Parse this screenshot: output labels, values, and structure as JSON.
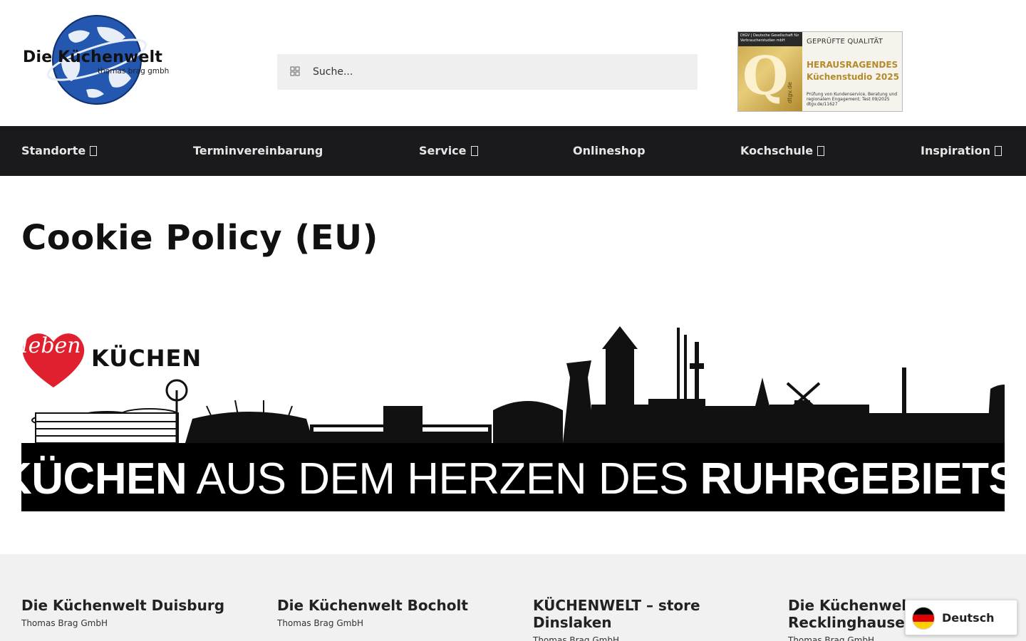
{
  "logo": {
    "title": "Die Küchenwelt",
    "subtitle": "thomas brag gmbh"
  },
  "search": {
    "placeholder": "Suche..."
  },
  "quality_badge": {
    "header": "DtGV | Deutsche Gesellschaft für Verbraucherstudien mbH",
    "vertical": "dtgv.de",
    "line1": "GEPRÜFTE QUALITÄT",
    "line2": "HERAUSRAGENDES",
    "line3": "Küchenstudio 2025",
    "line4": "Prüfung von Kundenservice, Beratung und regionalem Engagement; Test 09/2025 dtgv.de/11627"
  },
  "nav": {
    "items": [
      {
        "label": "Standorte",
        "has_submenu": true
      },
      {
        "label": "Terminvereinbarung",
        "has_submenu": false
      },
      {
        "label": "Service",
        "has_submenu": true
      },
      {
        "label": "Onlineshop",
        "has_submenu": false
      },
      {
        "label": "Kochschule",
        "has_submenu": true
      },
      {
        "label": "Inspiration",
        "has_submenu": true
      }
    ]
  },
  "page": {
    "title": "Cookie Policy (EU)"
  },
  "banner": {
    "heart_text": "leben",
    "word": "KÜCHEN",
    "slogan_part1": "KÜCHEN",
    "slogan_part2": " AUS DEM HERZEN DES ",
    "slogan_part3": "RUHRGEBIETS"
  },
  "footer": {
    "locations": [
      {
        "name": "Die Küchenwelt Duisburg",
        "company": "Thomas Brag GmbH"
      },
      {
        "name": "Die Küchenwelt Bocholt",
        "company": "Thomas Brag GmbH"
      },
      {
        "name": "KÜCHENWELT – store Dinslaken",
        "company": "Thomas Brag GmbH"
      },
      {
        "name": "Die Küchenwelt Recklinghausen",
        "company": "Thomas Brag GmbH"
      }
    ]
  },
  "language_switcher": {
    "label": "Deutsch",
    "flag": "germany-flag"
  },
  "colors": {
    "nav_bg": "#1a1a1c",
    "footer_bg": "#f1f1f1",
    "heart": "#e0202e",
    "badge_gold": "#b58a2b",
    "logo_blue": "#1f4fa3"
  }
}
